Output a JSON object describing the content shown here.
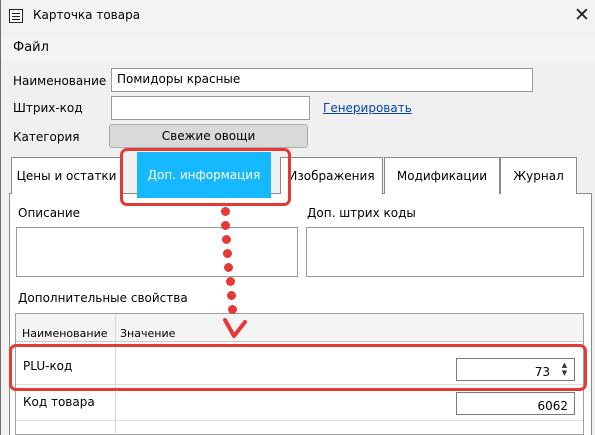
{
  "window": {
    "title": "Карточка товара",
    "close_icon": "close-icon",
    "app_icon": "barcode-document-icon"
  },
  "menu": {
    "file": "Файл"
  },
  "fields": {
    "name_label": "Наименование",
    "name_value": "Помидоры красные",
    "barcode_label": "Штрих-код",
    "barcode_value": "",
    "generate_link": "Генерировать",
    "category_label": "Категория",
    "category_button": "Свежие овощи"
  },
  "tabs": [
    {
      "label": "Цены и остатки",
      "active": false
    },
    {
      "label": "Доп. информация",
      "active": true
    },
    {
      "label": "Изображения",
      "active": false
    },
    {
      "label": "Модификации",
      "active": false
    },
    {
      "label": "Журнал",
      "active": false
    }
  ],
  "extra_info": {
    "description_label": "Описание",
    "description_value": "",
    "extra_barcodes_label": "Доп. штрих коды",
    "extra_barcodes_value": "",
    "properties_label": "Дополнительные свойства",
    "grid_headers": [
      "Наименование",
      "Значение"
    ],
    "rows": [
      {
        "name": "PLU-код",
        "value": "73"
      },
      {
        "name": "Код товара",
        "value": "6062"
      }
    ]
  },
  "colors": {
    "active_tab": "#16b8ff",
    "highlight": "#e53935",
    "link": "#0645ad"
  }
}
